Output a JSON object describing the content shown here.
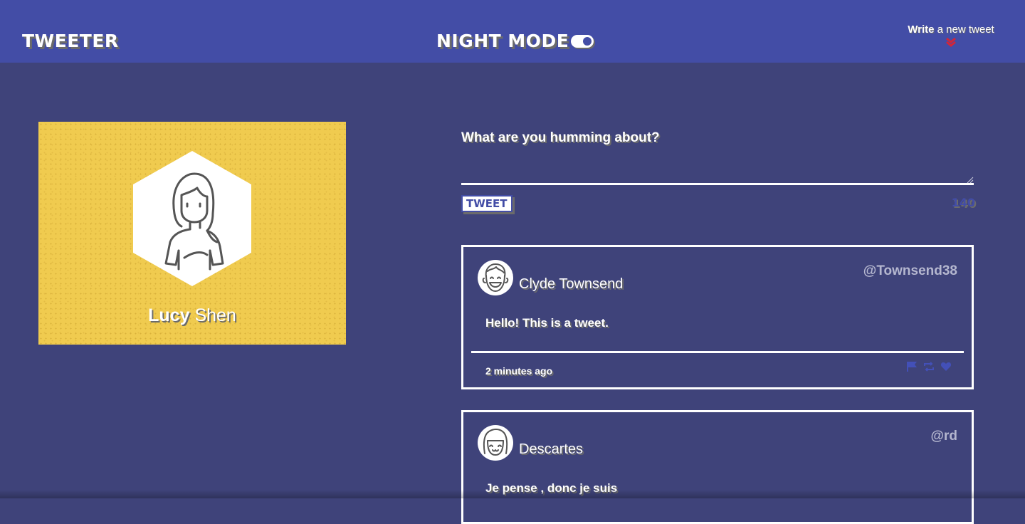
{
  "nav": {
    "brand": "Tweeter",
    "night_mode_label": "Night Mode",
    "compose_bold": "Write",
    "compose_rest": " a new tweet",
    "compose_chevron_icon": "double-chevron-down-icon"
  },
  "profile": {
    "first_name": "Lucy",
    "last_name": " Shen",
    "avatar_icon": "woman-avatar-icon"
  },
  "composer": {
    "label": "What are you humming about?",
    "value": "",
    "button_label": "Tweet",
    "counter": "140"
  },
  "tweets": [
    {
      "name": "Clyde Townsend",
      "handle": "@Townsend38",
      "body": "Hello! This is a tweet.",
      "time": "2 minutes ago",
      "avatar_icon": "smiling-boy-avatar-icon"
    },
    {
      "name": "Descartes",
      "handle": "@rd",
      "body": "Je pense , donc je suis",
      "avatar_icon": "girl-avatar-icon"
    }
  ],
  "actions": {
    "flag_icon": "flag-icon",
    "retweet_icon": "retweet-icon",
    "like_icon": "heart-icon"
  },
  "colors": {
    "nav_bg": "#434da6",
    "page_bg": "#3f437a",
    "profile_bg": "#f0cb4f",
    "chevron": "#d0263b"
  }
}
